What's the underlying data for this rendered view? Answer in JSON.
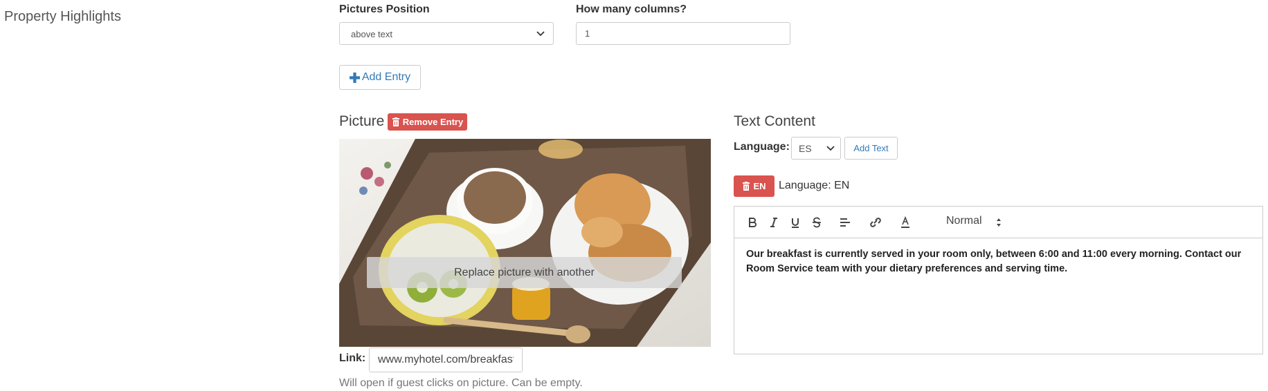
{
  "section": {
    "title": "Property Highlights"
  },
  "pictures_position": {
    "label": "Pictures Position",
    "value": "above text"
  },
  "columns": {
    "label": "How many columns?",
    "value": "1"
  },
  "add_entry": {
    "label": "Add Entry",
    "icon": "plus-icon"
  },
  "picture": {
    "heading": "Picture",
    "remove_label": "Remove Entry",
    "replace_label": "Replace picture with another",
    "link_label": "Link:",
    "link_value": "www.myhotel.com/breakfast",
    "help": "Will open if guest clicks on picture. Can be empty."
  },
  "text_content": {
    "heading": "Text Content",
    "language_label": "Language:",
    "language_value": "ES",
    "add_text_label": "Add Text",
    "tag_label": "EN",
    "tag_language": "Language: EN",
    "toolbar": {
      "format_value": "Normal"
    },
    "body": "Our breakfast is currently served in your room only, between 6:00 and 11:00 every morning. Contact our Room Service team with your dietary preferences and serving time."
  },
  "colors": {
    "accent": "#337ab7",
    "danger": "#d9534f"
  }
}
